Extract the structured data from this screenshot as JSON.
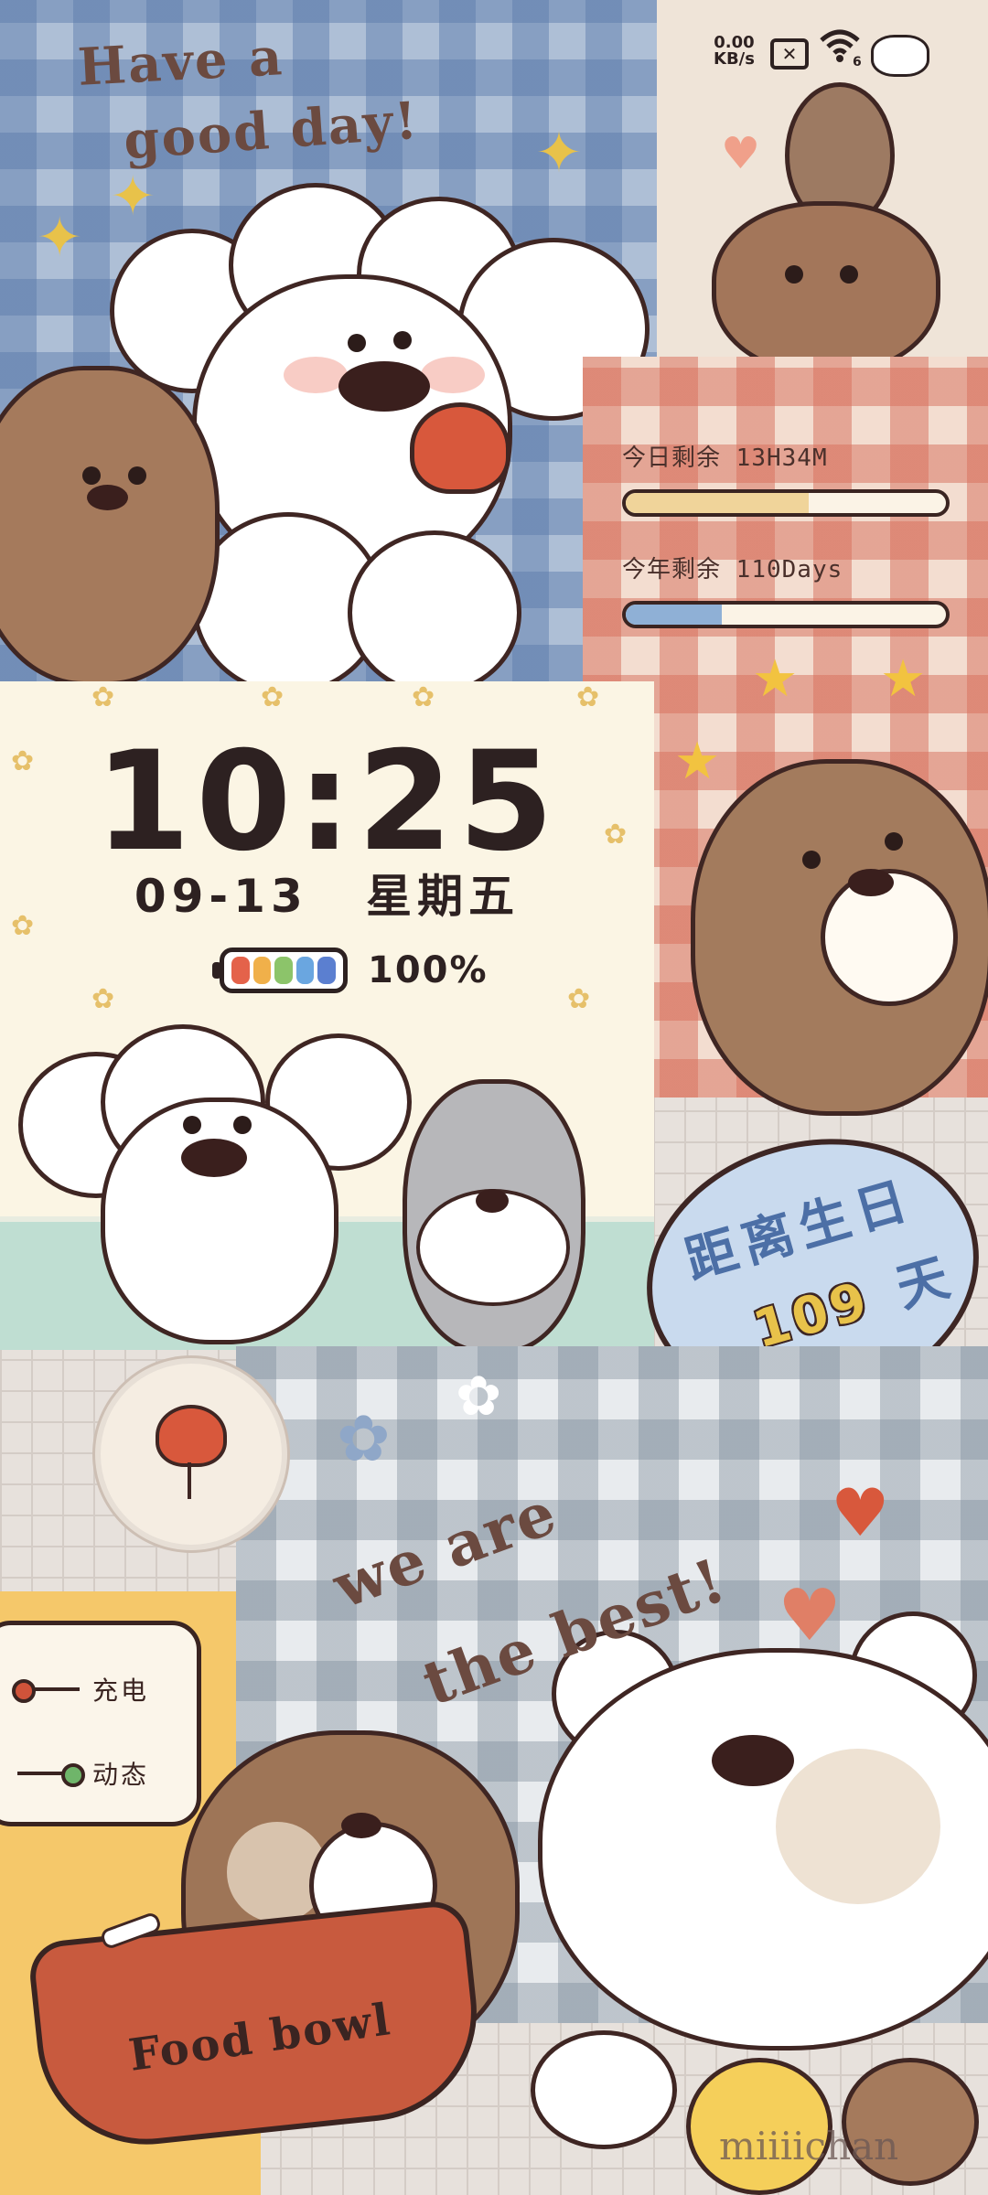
{
  "status_bar": {
    "net_speed_value": "0.00",
    "net_speed_unit": "KB/s",
    "wifi_badge": "6"
  },
  "greeting": {
    "line1": "Have a",
    "line2": "good day!"
  },
  "countdowns": {
    "today": {
      "label": "今日剩余",
      "value": "13H34M",
      "fraction": 0.57
    },
    "year": {
      "label": "今年剩余",
      "value": "110Days",
      "fraction": 0.3
    }
  },
  "clock": {
    "time": "10:25",
    "date": "09-13",
    "weekday": "星期五",
    "battery_text": "100%",
    "battery_level": 1.0
  },
  "birthday": {
    "line1": "距离生日",
    "days": "109",
    "unit": "天"
  },
  "slogan": {
    "line1": "we are",
    "line2": "the best!"
  },
  "toggles": [
    {
      "label": "充电",
      "state": "off",
      "color": "#d0533a"
    },
    {
      "label": "动态",
      "state": "on",
      "color": "#6fb56a"
    }
  ],
  "bowl_text": "Food bowl",
  "watermark": "miiiichan",
  "colors": {
    "battery_cells": [
      "#e4624a",
      "#f0b04a",
      "#8cc46a",
      "#6aa6e0",
      "#5b7fd0"
    ],
    "progress_today": "#f0d49a",
    "progress_year": "#8fb0d6"
  }
}
